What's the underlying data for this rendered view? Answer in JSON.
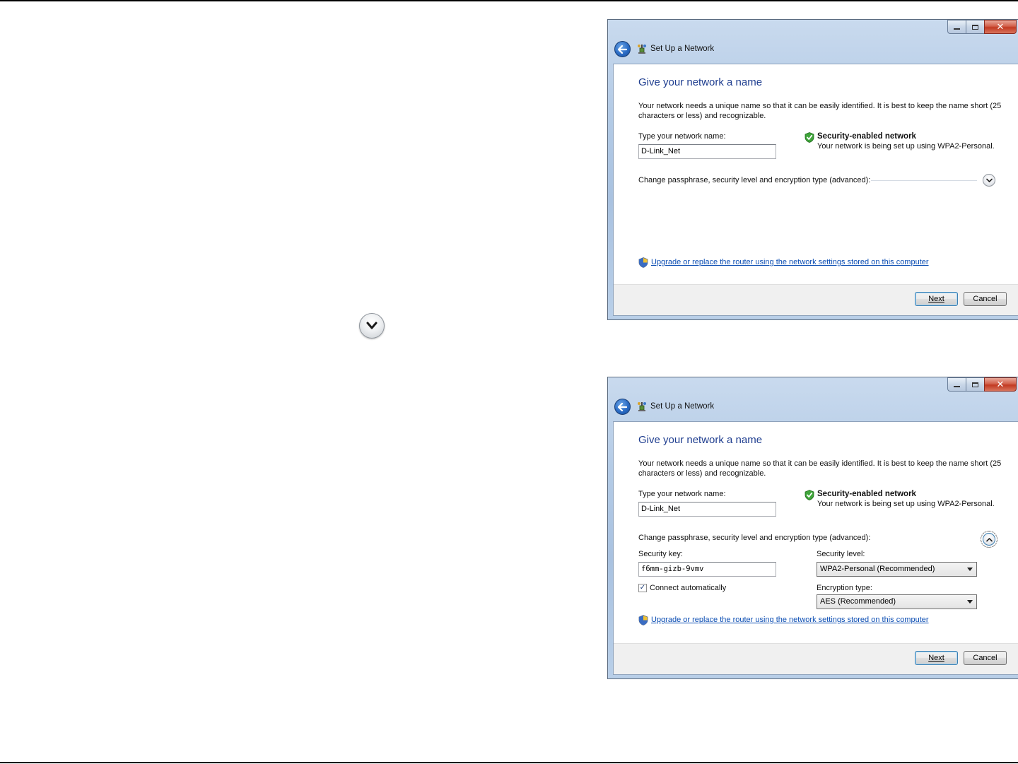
{
  "colors": {
    "heading": "#1e3d8f",
    "link": "#0b4db3",
    "accent_button_border": "#3c7fb1",
    "close_button": "#c23a22"
  },
  "windows": [
    {
      "title": "Set Up a Network",
      "heading": "Give your network a name",
      "description": "Your network needs a unique name so that it can be easily identified. It is best to keep the name short (25 characters or less) and recognizable.",
      "name_label": "Type your network name:",
      "name_value": "D-Link_Net",
      "security_title": "Security-enabled network",
      "security_desc": "Your network is being set up using WPA2-Personal.",
      "advanced_label": "Change passphrase, security level and encryption type (advanced):",
      "upgrade_link": "Upgrade or replace the router using the network settings stored on this computer",
      "next_label": "Next",
      "cancel_label": "Cancel"
    },
    {
      "title": "Set Up a Network",
      "heading": "Give your network a name",
      "description": "Your network needs a unique name so that it can be easily identified. It is best to keep the name short (25 characters or less) and recognizable.",
      "name_label": "Type your network name:",
      "name_value": "D-Link_Net",
      "security_title": "Security-enabled network",
      "security_desc": "Your network is being set up using WPA2-Personal.",
      "advanced_label": "Change passphrase, security level and encryption type (advanced):",
      "security_key_label": "Security key:",
      "security_key_value": "f6mm-gizb-9vmv",
      "connect_auto_label": "Connect automatically",
      "connect_auto_checked": true,
      "security_level_label": "Security level:",
      "security_level_value": "WPA2-Personal (Recommended)",
      "encryption_type_label": "Encryption type:",
      "encryption_type_value": "AES (Recommended)",
      "upgrade_link": "Upgrade or replace the router using the network settings stored on this computer",
      "next_label": "Next",
      "cancel_label": "Cancel"
    }
  ]
}
